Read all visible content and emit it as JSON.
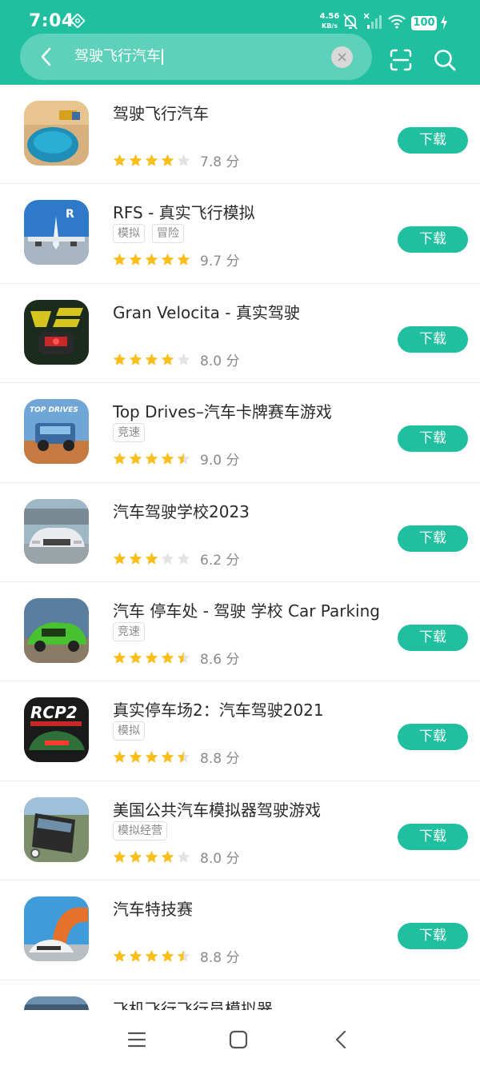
{
  "status_bar": {
    "time": "7:04",
    "net_speed_value": "4.56",
    "net_speed_unit": "KB/s",
    "battery": "100"
  },
  "search": {
    "query": "驾驶飞行汽车",
    "back_icon": "chevron-left-icon",
    "clear_icon": "close-icon",
    "scan_icon": "scan-icon",
    "search_icon": "search-icon"
  },
  "download_label": "下载",
  "colors": {
    "brand": "#1fbf9f",
    "star": "#fbbe1a",
    "star_empty": "#e3e3e3"
  },
  "apps": [
    {
      "title": "驾驶飞行汽车",
      "tags": [],
      "rating": 4,
      "score": "7.8 分"
    },
    {
      "title": "RFS - 真实飞行模拟",
      "tags": [
        "模拟",
        "冒险"
      ],
      "rating": 5,
      "score": "9.7 分"
    },
    {
      "title": "Gran Velocita - 真实驾驶",
      "tags": [],
      "rating": 4,
      "score": "8.0 分"
    },
    {
      "title": "Top Drives–汽车卡牌赛车游戏",
      "tags": [
        "竞速"
      ],
      "rating": 4.5,
      "score": "9.0 分"
    },
    {
      "title": "汽车驾驶学校2023",
      "tags": [],
      "rating": 3,
      "score": "6.2 分"
    },
    {
      "title": "汽车 停车处 - 驾驶 学校 Car Parking",
      "tags": [
        "竞速"
      ],
      "rating": 4.5,
      "score": "8.6 分"
    },
    {
      "title": "真实停车场2：汽车驾驶2021",
      "tags": [
        "模拟"
      ],
      "rating": 4.5,
      "score": "8.8 分"
    },
    {
      "title": "美国公共汽车模拟器驾驶游戏",
      "tags": [
        "模拟经营"
      ],
      "rating": 4,
      "score": "8.0 分"
    },
    {
      "title": "汽车特技赛",
      "tags": [],
      "rating": 4.5,
      "score": "8.8 分"
    },
    {
      "title": "飞机飞行飞行员模拟器",
      "tags": [],
      "rating": 0,
      "score": ""
    }
  ],
  "nav": {
    "menu_icon": "menu-icon",
    "home_icon": "home-icon",
    "back_icon": "back-icon"
  }
}
